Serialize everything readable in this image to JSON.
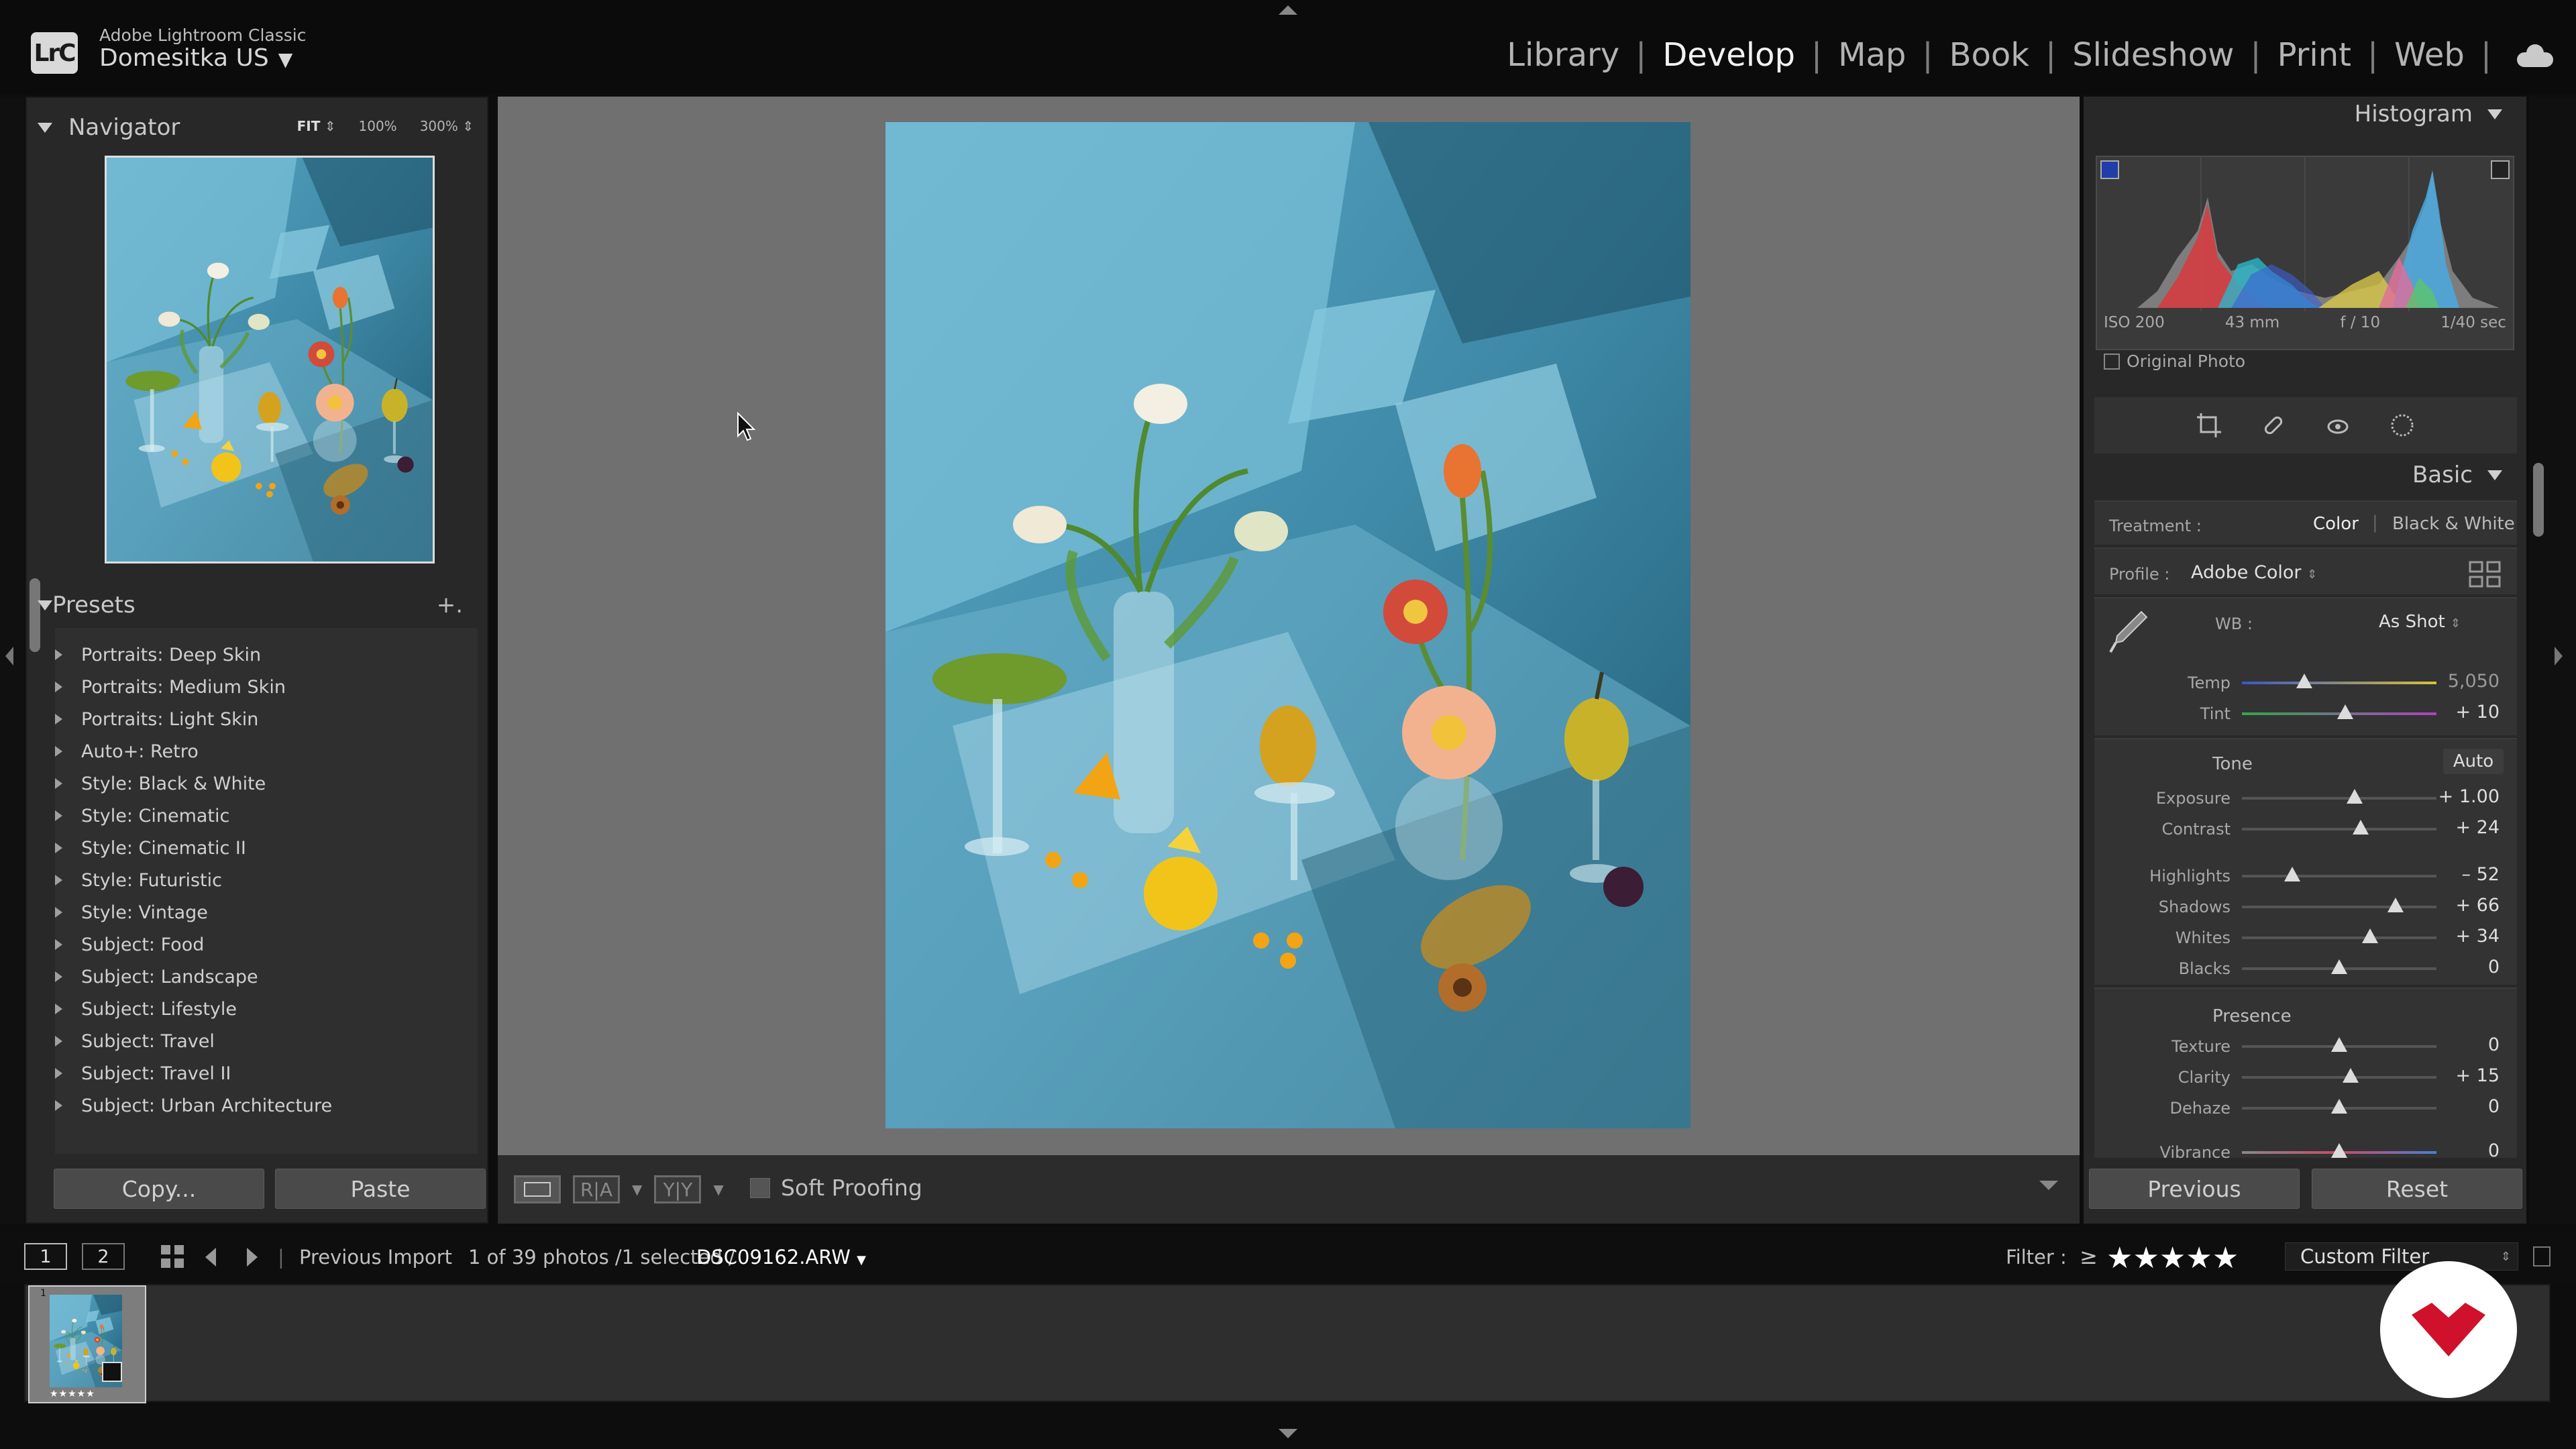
{
  "app": {
    "logo_text": "LrC",
    "product_name": "Adobe Lightroom Classic",
    "catalog_name": "Domesitka US",
    "modules": [
      "Library",
      "Develop",
      "Map",
      "Book",
      "Slideshow",
      "Print",
      "Web"
    ],
    "active_module": "Develop"
  },
  "navigator": {
    "title": "Navigator",
    "zoom_levels": [
      "FIT",
      "100%",
      "300%"
    ]
  },
  "presets": {
    "title": "Presets",
    "add_symbol": "+.",
    "items": [
      "Portraits: Deep Skin",
      "Portraits: Medium Skin",
      "Portraits: Light Skin",
      "Auto+: Retro",
      "Style: Black & White",
      "Style: Cinematic",
      "Style: Cinematic II",
      "Style: Futuristic",
      "Style: Vintage",
      "Subject: Food",
      "Subject: Landscape",
      "Subject: Lifestyle",
      "Subject: Travel",
      "Subject: Travel II",
      "Subject: Urban Architecture"
    ]
  },
  "left_buttons": {
    "copy": "Copy...",
    "paste": "Paste"
  },
  "toolbar": {
    "soft_proofing": "Soft Proofing",
    "before_after_1": "R|A",
    "before_after_2": "Y|Y"
  },
  "histogram": {
    "title": "Histogram",
    "iso": "ISO 200",
    "focal": "43 mm",
    "aperture": "f / 10",
    "shutter": "1/40 sec",
    "original_photo": "Original Photo"
  },
  "basic": {
    "title": "Basic",
    "treatment_label": "Treatment :",
    "treatment_color": "Color",
    "treatment_bw": "Black & White",
    "profile_label": "Profile :",
    "profile_value": "Adobe Color",
    "wb_label": "WB :",
    "wb_value": "As Shot",
    "tone_label": "Tone",
    "auto_label": "Auto",
    "presence_label": "Presence",
    "sliders": [
      {
        "label": "Temp",
        "value": "5,050",
        "pos": 0.32
      },
      {
        "label": "Tint",
        "value": "+ 10",
        "pos": 0.53
      },
      {
        "label": "Exposure",
        "value": "+ 1.00",
        "pos": 0.58
      },
      {
        "label": "Contrast",
        "value": "+ 24",
        "pos": 0.61
      },
      {
        "label": "Highlights",
        "value": "– 52",
        "pos": 0.26
      },
      {
        "label": "Shadows",
        "value": "+ 66",
        "pos": 0.79
      },
      {
        "label": "Whites",
        "value": "+ 34",
        "pos": 0.66
      },
      {
        "label": "Blacks",
        "value": "0",
        "pos": 0.5
      },
      {
        "label": "Texture",
        "value": "0",
        "pos": 0.5
      },
      {
        "label": "Clarity",
        "value": "+ 15",
        "pos": 0.56
      },
      {
        "label": "Dehaze",
        "value": "0",
        "pos": 0.5
      },
      {
        "label": "Vibrance",
        "value": "0",
        "pos": 0.5
      }
    ]
  },
  "right_buttons": {
    "previous": "Previous",
    "reset": "Reset"
  },
  "filmstrip_bar": {
    "screen1": "1",
    "screen2": "2",
    "source": "Previous Import",
    "count": "1 of 39 photos /1 selected /",
    "filename": "DSC09162.ARW",
    "filter_label": "Filter :",
    "filter_op": "≥",
    "stars": "★★★★★",
    "custom_filter": "Custom Filter"
  },
  "thumb": {
    "number": "1",
    "rating": "★★★★★"
  }
}
